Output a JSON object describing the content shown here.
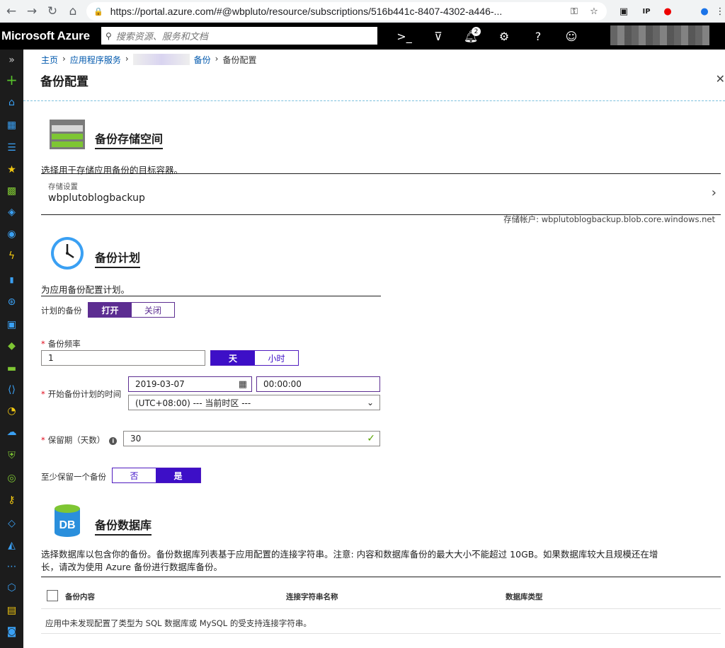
{
  "browser": {
    "url": "https://portal.azure.com/#@wbpluto/resource/subscriptions/516b441c-8407-4302-a446-..."
  },
  "azure": {
    "brand": "Microsoft Azure",
    "search_placeholder": "搜索资源、服务和文档",
    "notification_count": "2"
  },
  "breadcrumb": {
    "home": "主页",
    "app_services": "应用程序服务",
    "backups": "备份",
    "current": "备份配置"
  },
  "page": {
    "title": "备份配置"
  },
  "storage": {
    "title": "备份存储空间",
    "description": "选择用于存储应用备份的目标容器。",
    "setting_label": "存储设置",
    "setting_value": "wbplutoblogbackup",
    "account": "存储帐户: wbplutoblogbackup.blob.core.windows.net"
  },
  "schedule": {
    "title": "备份计划",
    "description": "为应用备份配置计划。",
    "scheduled_label": "计划的备份",
    "scheduled_on": "打开",
    "scheduled_off": "关闭",
    "frequency_label": "备份频率",
    "frequency_value": "1",
    "unit_day": "天",
    "unit_hour": "小时",
    "start_label": "开始备份计划的时间",
    "start_date": "2019-03-07",
    "start_time": "00:00:00",
    "timezone": "(UTC+08:00) --- 当前时区 ---",
    "retention_label": "保留期（天数）",
    "retention_value": "30",
    "keep_one_label": "至少保留一个备份",
    "keep_no": "否",
    "keep_yes": "是"
  },
  "database": {
    "title": "备份数据库",
    "icon_text": "DB",
    "description_line1": "选择数据库以包含你的备份。备份数据库列表基于应用配置的连接字符串。注意: 内容和数据库备份的最大大小不能超过 10GB。如果数据库较大且规模还在增",
    "description_line2": "长，请改为使用 Azure 备份进行数据库备份。",
    "col_content": "备份内容",
    "col_connection": "连接字符串名称",
    "col_type": "数据库类型",
    "empty": "应用中未发现配置了类型为 SQL 数据库或 MySQL 的受支持连接字符串。"
  }
}
